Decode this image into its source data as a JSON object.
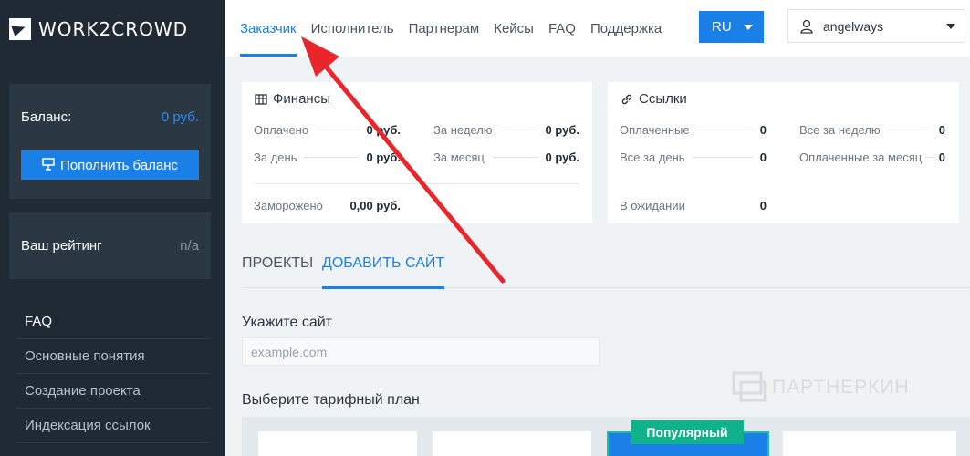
{
  "brand": {
    "logo_text": "WORK2CROWD"
  },
  "sidebar": {
    "balance_label": "Баланс:",
    "balance_value": "0 руб.",
    "topup_button": "Пополнить баланс",
    "rating_label": "Ваш рейтинг",
    "rating_value": "n/a",
    "menu_items": [
      "FAQ",
      "Основные понятия",
      "Создание проекта",
      "Индексация ссылок"
    ]
  },
  "nav": {
    "items": [
      "Заказчик",
      "Исполнитель",
      "Партнерам",
      "Кейсы",
      "FAQ",
      "Поддержка"
    ],
    "active_index": 0,
    "language": "RU",
    "username": "angelways"
  },
  "finance": {
    "title": "Финансы",
    "paid_label": "Оплачено",
    "paid_value": "0 руб.",
    "day_label": "За день",
    "day_value": "0 руб.",
    "week_label": "За неделю",
    "week_value": "0 руб.",
    "month_label": "За месяц",
    "month_value": "0 руб.",
    "frozen_label": "Заморожено",
    "frozen_value": "0,00 руб."
  },
  "links": {
    "title": "Ссылки",
    "paid_label": "Оплаченные",
    "paid_value": "0",
    "all_day_label": "Все за день",
    "all_day_value": "0",
    "all_week_label": "Все за неделю",
    "all_week_value": "0",
    "paid_month_label": "Оплаченные за месяц",
    "paid_month_value": "0",
    "pending_label": "В ожидании",
    "pending_value": "0"
  },
  "tabs": {
    "projects": "ПРОЕКТЫ",
    "add_site": "ДОБАВИТЬ САЙТ"
  },
  "form": {
    "site_label": "Укажите сайт",
    "site_placeholder": "example.com",
    "plan_label": "Выберите тарифный план",
    "popular_badge": "Популярный"
  },
  "watermark": {
    "text": "ПАРТНЕРКИН"
  },
  "colors": {
    "accent": "#1b7fe8",
    "sidebar_bg": "#1f2a35",
    "badge": "#0fb28a",
    "annotation_arrow": "#e8262b"
  }
}
